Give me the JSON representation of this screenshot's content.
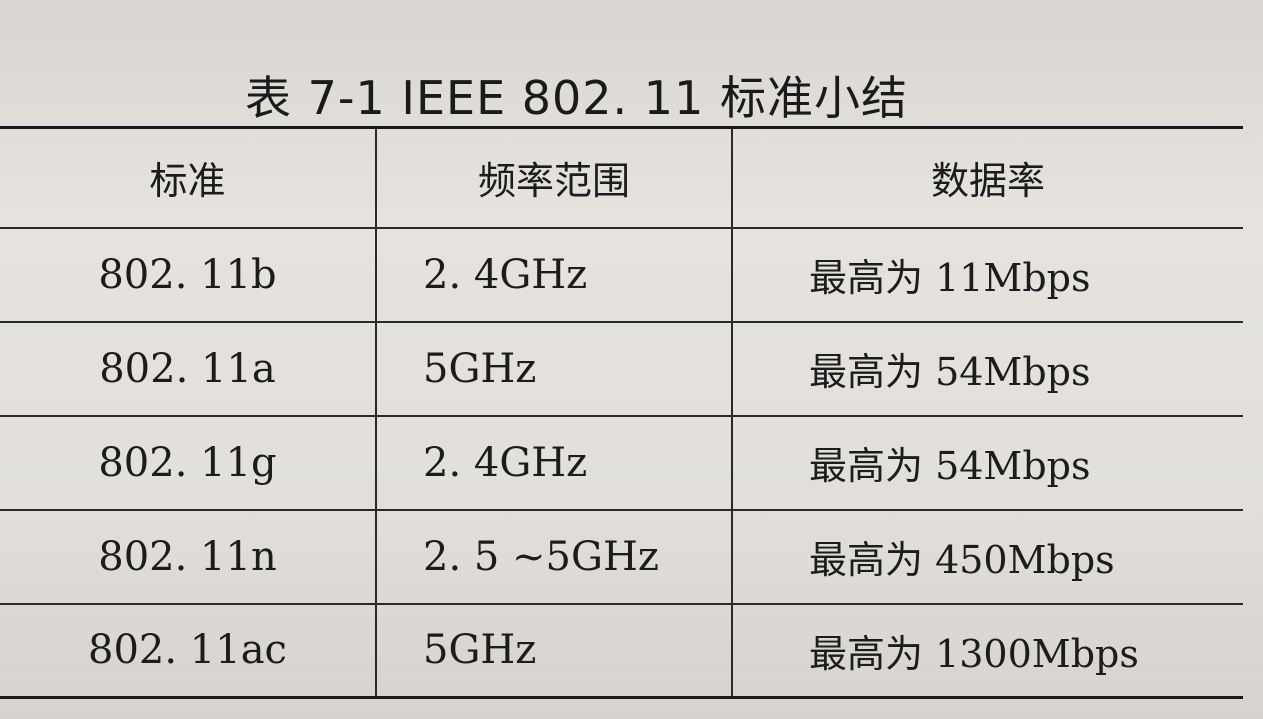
{
  "document": {
    "table_title": "表 7-1   IEEE 802. 11 标准小结",
    "headers": {
      "standard": "标准",
      "frequency": "频率范围",
      "data_rate": "数据率"
    },
    "rows": [
      {
        "standard": "802. 11b",
        "frequency": "2. 4GHz",
        "data_rate": "最高为 11Mbps"
      },
      {
        "standard": "802. 11a",
        "frequency": "5GHz",
        "data_rate": "最高为 54Mbps"
      },
      {
        "standard": "802. 11g",
        "frequency": "2. 4GHz",
        "data_rate": "最高为 54Mbps"
      },
      {
        "standard": "802. 11n",
        "frequency": "2. 5 ~5GHz",
        "data_rate": "最高为 450Mbps"
      },
      {
        "standard": "802. 11ac",
        "frequency": "5GHz",
        "data_rate": "最高为 1300Mbps"
      }
    ]
  }
}
